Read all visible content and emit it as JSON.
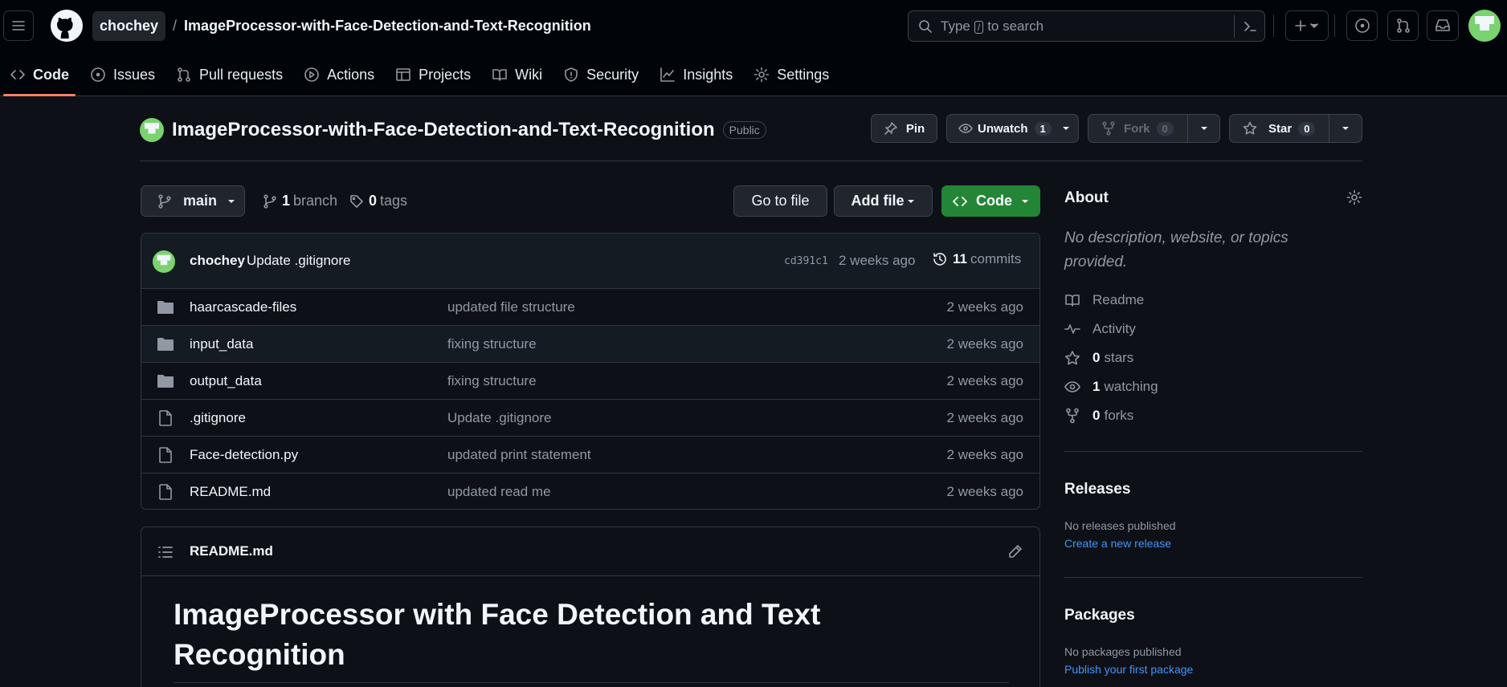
{
  "header": {
    "owner": "chochey",
    "separator": "/",
    "repo": "ImageProcessor-with-Face-Detection-and-Text-Recognition",
    "search_prefix": "Type",
    "search_key": "/",
    "search_suffix": "to search"
  },
  "repo_nav": [
    {
      "label": "Code",
      "icon": "code-icon"
    },
    {
      "label": "Issues",
      "icon": "issue-icon"
    },
    {
      "label": "Pull requests",
      "icon": "pull-request-icon"
    },
    {
      "label": "Actions",
      "icon": "play-icon"
    },
    {
      "label": "Projects",
      "icon": "table-icon"
    },
    {
      "label": "Wiki",
      "icon": "book-icon"
    },
    {
      "label": "Security",
      "icon": "shield-icon"
    },
    {
      "label": "Insights",
      "icon": "graph-icon"
    },
    {
      "label": "Settings",
      "icon": "gear-icon"
    }
  ],
  "repo_title": {
    "name": "ImageProcessor-with-Face-Detection-and-Text-Recognition",
    "visibility": "Public",
    "pin": "Pin",
    "unwatch": "Unwatch",
    "watch_count": "1",
    "fork": "Fork",
    "fork_count": "0",
    "star": "Star",
    "star_count": "0"
  },
  "branch_bar": {
    "branch": "main",
    "branch_count": "1",
    "branch_label": "branch",
    "tag_count": "0",
    "tag_label": "tags",
    "go_to_file": "Go to file",
    "add_file": "Add file",
    "code": "Code"
  },
  "latest_commit": {
    "author": "chochey",
    "message": "Update .gitignore",
    "sha": "cd391c1",
    "time": "2 weeks ago",
    "count": "11",
    "count_label": "commits"
  },
  "files": [
    {
      "type": "folder",
      "name": "haarcascade-files",
      "commit": "updated file structure",
      "time": "2 weeks ago"
    },
    {
      "type": "folder",
      "name": "input_data",
      "commit": "fixing structure",
      "time": "2 weeks ago"
    },
    {
      "type": "folder",
      "name": "output_data",
      "commit": "fixing structure",
      "time": "2 weeks ago"
    },
    {
      "type": "file",
      "name": ".gitignore",
      "commit": "Update .gitignore",
      "time": "2 weeks ago"
    },
    {
      "type": "file",
      "name": "Face-detection.py",
      "commit": "updated print statement",
      "time": "2 weeks ago"
    },
    {
      "type": "file",
      "name": "README.md",
      "commit": "updated read me",
      "time": "2 weeks ago"
    }
  ],
  "readme": {
    "filename": "README.md",
    "heading": "ImageProcessor with Face Detection and Text Recognition"
  },
  "about": {
    "title": "About",
    "description": "No description, website, or topics provided.",
    "readme": "Readme",
    "activity": "Activity",
    "stars_count": "0",
    "stars_label": "stars",
    "watching_count": "1",
    "watching_label": "watching",
    "forks_count": "0",
    "forks_label": "forks"
  },
  "releases": {
    "title": "Releases",
    "empty": "No releases published",
    "link": "Create a new release"
  },
  "packages": {
    "title": "Packages",
    "empty": "No packages published",
    "link": "Publish your first package"
  },
  "colors": {
    "background": "#0d1117",
    "header": "#010409",
    "accent_green": "#238636",
    "link_blue": "#4493f8",
    "tab_underline": "#f78166"
  }
}
